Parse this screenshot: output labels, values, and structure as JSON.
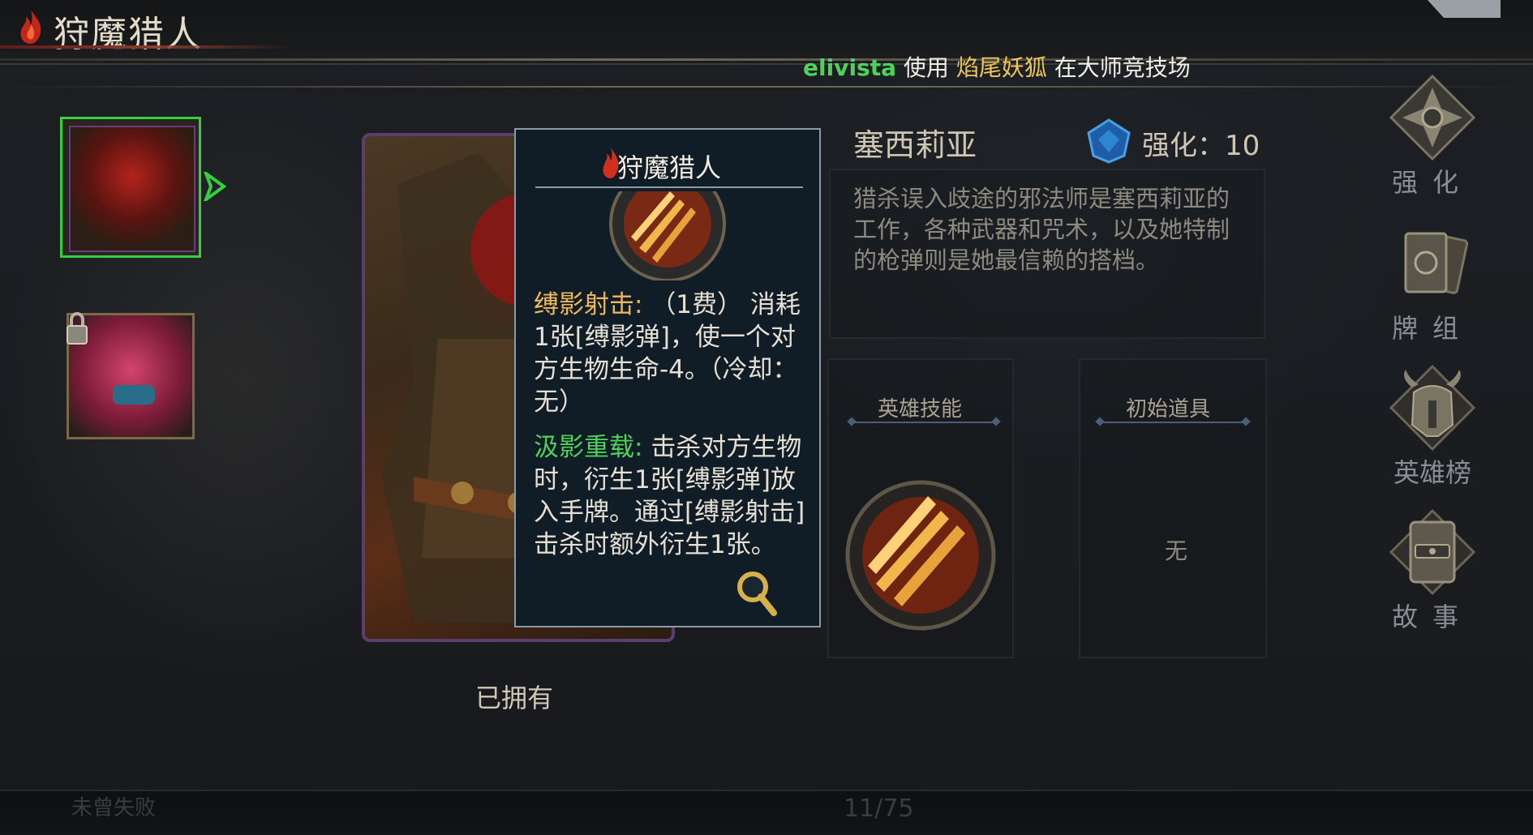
{
  "header": {
    "title": "狩魔猎人",
    "flame_icon": "flame-icon"
  },
  "marquee": {
    "user": "elivista",
    "verb": "使用",
    "hero": "焰尾妖狐",
    "rest": "在大师竞技场"
  },
  "hero_list": {
    "lock_icon": "lock-icon"
  },
  "card": {
    "owned_label": "已拥有"
  },
  "tooltip": {
    "title": "狩魔猎人",
    "skill1_name": "缚影射击:",
    "skill1_cost": "（1费）",
    "skill1_desc": "消耗1张[缚影弹]，使一个对方生物生命-4。（冷却：无）",
    "skill2_name": "汲影重载:",
    "skill2_desc": "击杀对方生物时，衍生1张[缚影弹]放入手牌。通过[缚影射击]击杀时额外衍生1张。"
  },
  "info": {
    "hero_name": "塞西莉亚",
    "enhance_label": "强化：",
    "enhance_value": "10",
    "description": "猎杀误入歧途的邪法师是塞西莉亚的工作，各种武器和咒术，以及她特制的枪弹则是她最信赖的搭档。",
    "hero_skill_title": "英雄技能",
    "starting_item_title": "初始道具",
    "starting_item_value": "无"
  },
  "menu": {
    "enhance": "强化",
    "deck": "牌组",
    "leaderboard": "英雄榜",
    "story": "故事"
  },
  "footer": {
    "page": "11/75",
    "left_text": "未曾失败"
  },
  "colors": {
    "accent_green": "#34d03e",
    "highlight_gold": "#f1c75a",
    "tooltip_bg": "#111d26"
  }
}
